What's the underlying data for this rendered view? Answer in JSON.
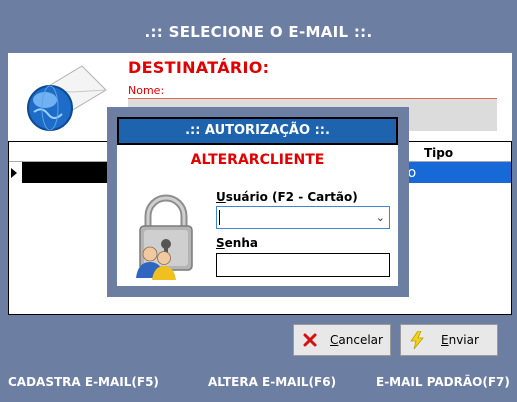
{
  "window": {
    "title": ".:: SELECIONE O E-MAIL ::."
  },
  "form": {
    "destinatario_label": "DESTINATÁRIO:",
    "nome_label": "Nome:"
  },
  "grid": {
    "column_tipo": "Tipo",
    "selected_row_text": "ão"
  },
  "buttons": {
    "cancel": {
      "underline": "C",
      "rest": "ancelar"
    },
    "send": {
      "underline": "E",
      "rest": "nviar"
    }
  },
  "shortcuts": {
    "cadastra": "CADASTRA E-MAIL(F5)",
    "altera": "ALTERA E-MAIL(F6)",
    "padrao": "E-MAIL PADRÃO(F7)"
  },
  "auth_dialog": {
    "title": ".:: AUTORIZAÇÃO ::.",
    "subtitle": "ALTERARCLIENTE",
    "usuario_label": {
      "underline": "U",
      "rest": "suário (F2 - Cartão)"
    },
    "usuario_value": "",
    "senha_label": {
      "underline": "S",
      "rest": "enha"
    },
    "senha_value": ""
  },
  "colors": {
    "background": "#6d7ea3",
    "label_red": "#e00000",
    "dialog_title_blue": "#1e63ad",
    "selection_blue": "#1769d8"
  }
}
